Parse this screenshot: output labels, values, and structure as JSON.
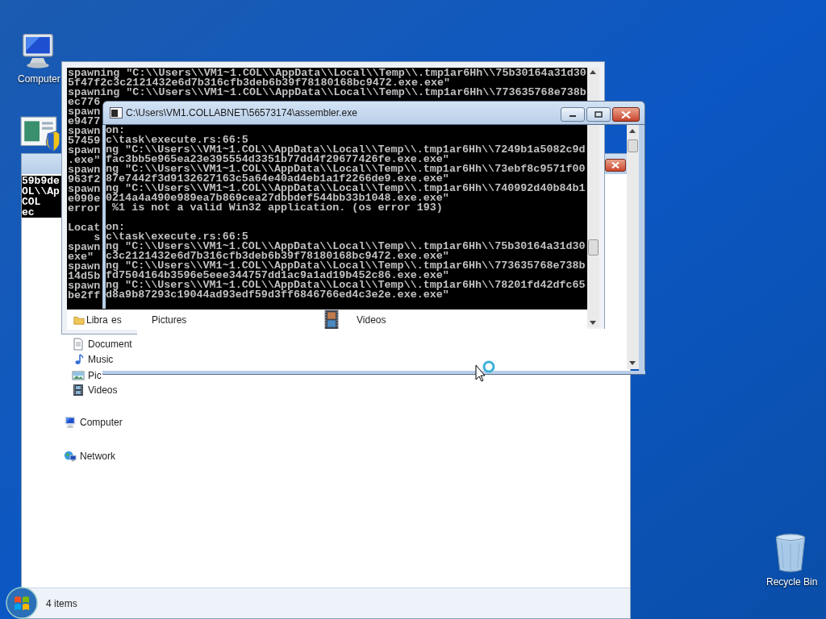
{
  "desktop_icons": [
    {
      "kind": "computer",
      "label": "Computer"
    },
    {
      "kind": "control-panel"
    },
    {
      "kind": "recycle-bin",
      "label": "Recycle Bin"
    }
  ],
  "explorer": {
    "glitch_text": [
      "59b9de",
      "OL\\\\Ap",
      "COL",
      "ec"
    ],
    "nav_items": [
      {
        "kind": "document",
        "label": "Document"
      },
      {
        "kind": "music",
        "label": "Music"
      },
      {
        "kind": "pictures",
        "label": "Pic"
      },
      {
        "kind": "videos",
        "label": "Videos"
      },
      {
        "kind": "computer",
        "label": "Computer"
      },
      {
        "kind": "network",
        "label": "Network"
      }
    ],
    "status_text": "4 items"
  },
  "back_console": {
    "lines": [
      {
        "text": "spawning \"C:\\\\Users\\\\VM1~1.COL\\\\AppData\\\\Local\\\\Temp\\\\.tmp1ar6Hh\\\\75b30164a31d30"
      },
      {
        "text": "5f47f2c3c2121432e6d7b316cfb3deb6b39f78180168bc9472.exe.exe\""
      },
      {
        "text": "spawning \"C:\\\\Users\\\\VM1~1.COL\\\\AppData\\\\Local\\\\Temp\\\\.tmp1ar6Hh\\\\773635768e738b"
      },
      {
        "text": "ec776"
      },
      {
        "text": "spawn"
      },
      {
        "text": "e9477"
      },
      {
        "text": "spawn"
      },
      {
        "text": "57459"
      },
      {
        "text": "spawn"
      },
      {
        "text": ".exe\""
      },
      {
        "text": "spawn"
      },
      {
        "text": "963f2"
      },
      {
        "text": "spawn"
      },
      {
        "text": "e090e"
      },
      {
        "text": "error"
      },
      {
        "text": "Locat",
        "gap_before": true
      },
      {
        "text": "    s"
      },
      {
        "text": "spawn"
      },
      {
        "text": "exe\""
      },
      {
        "text": "spawn"
      },
      {
        "text": "14d5b"
      },
      {
        "text": "spawn"
      },
      {
        "text": "be2ff"
      }
    ],
    "strip": [
      {
        "kind": "folder",
        "label": "Libra"
      },
      {
        "kind": "text",
        "label": "es"
      },
      {
        "kind": "text",
        "label": "Pictures"
      },
      {
        "kind": "film",
        "label": "Videos"
      }
    ]
  },
  "front_console": {
    "title": "C:\\Users\\VM1.COLLABNET\\56573174\\assembler.exe",
    "lines": [
      {
        "text": "on:"
      },
      {
        "text": "c\\task\\execute.rs:66:5"
      },
      {
        "text": "ng \"C:\\\\Users\\\\VM1~1.COL\\\\AppData\\\\Local\\\\Temp\\\\.tmp1ar6Hh\\\\7249b1a5082c9d"
      },
      {
        "text": "fac3bb5e965ea23e395554d3351b77dd4f29677426fe.exe.exe\""
      },
      {
        "text": "ng \"C:\\\\Users\\\\VM1~1.COL\\\\AppData\\\\Local\\\\Temp\\\\.tmp1ar6Hh\\\\73ebf8c9571f00"
      },
      {
        "text": "87e7442f3d9132627163c5a64e40ad4eb1a1f2266de9.exe.exe\""
      },
      {
        "text": "ng \"C:\\\\Users\\\\VM1~1.COL\\\\AppData\\\\Local\\\\Temp\\\\.tmp1ar6Hh\\\\740992d40b84b1"
      },
      {
        "text": "0214a4a490e989ea7b869cea27dbbdef544bb33b1048.exe.exe\""
      },
      {
        "text": " %1 is not a valid Win32 application. (os error 193)"
      },
      {
        "text": "on:",
        "gap_before": true
      },
      {
        "text": "c\\task\\execute.rs:66:5"
      },
      {
        "text": "ng \"C:\\\\Users\\\\VM1~1.COL\\\\AppData\\\\Local\\\\Temp\\\\.tmp1ar6Hh\\\\75b30164a31d30"
      },
      {
        "text": "c3c2121432e6d7b316cfb3deb6b39f78180168bc9472.exe.exe\""
      },
      {
        "text": "ng \"C:\\\\Users\\\\VM1~1.COL\\\\AppData\\\\Local\\\\Temp\\\\.tmp1ar6Hh\\\\773635768e738b"
      },
      {
        "text": "fd7504164b3596e5eee344757dd1ac9a1ad19b452c86.exe.exe\""
      },
      {
        "text": "ng \"C:\\\\Users\\\\VM1~1.COL\\\\AppData\\\\Local\\\\Temp\\\\.tmp1ar6Hh\\\\78201fd42dfc65"
      },
      {
        "text": "d8a9b87293c19044ad93edf59d3ff6846766ed4c3e2e.exe.exe\""
      }
    ]
  }
}
